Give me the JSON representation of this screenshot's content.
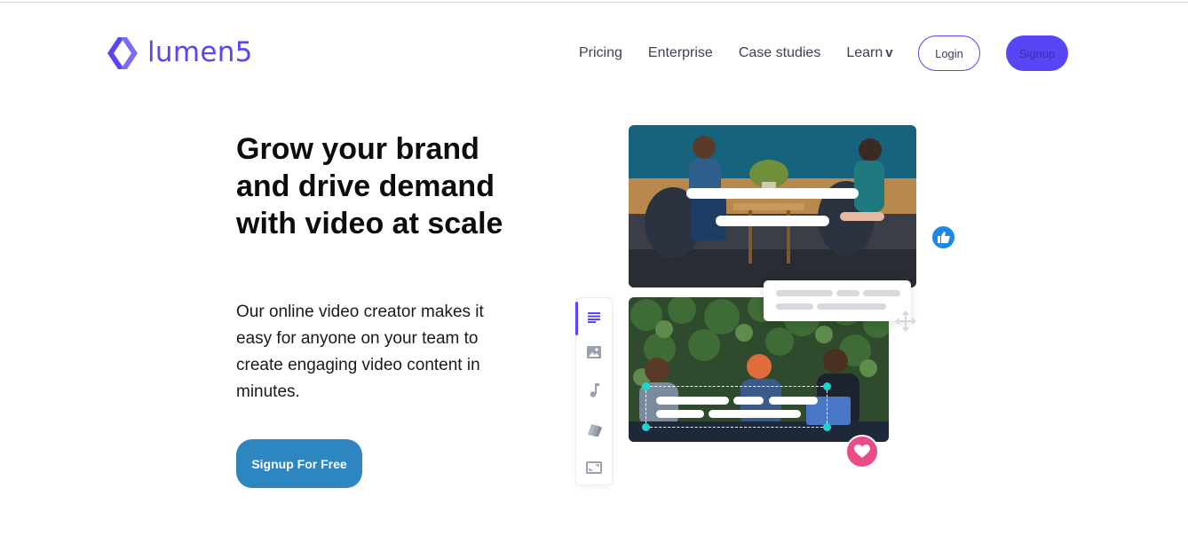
{
  "brand": {
    "name": "lumen5",
    "accent": "#5846f6",
    "logo_icon": "lumen5-diamond-logo"
  },
  "nav": {
    "links": [
      {
        "label": "Pricing"
      },
      {
        "label": "Enterprise"
      },
      {
        "label": "Case studies"
      },
      {
        "label": "Learn",
        "suffix": "v"
      }
    ],
    "login_label": "Login",
    "signup_label": "Signup"
  },
  "hero": {
    "title": "Grow your brand and drive demand with video at scale",
    "subtitle": "Our online video creator makes it easy for anyone on your team to create engaging video content in minutes.",
    "cta_label": "Signup For Free",
    "cta_color": "#2e86c1"
  },
  "illustration": {
    "toolbar_icons": [
      "text-icon",
      "image-icon",
      "music-icon",
      "color-palette-icon",
      "aspect-ratio-icon"
    ],
    "badges": {
      "like": "thumbs-up-icon",
      "like_color": "#1e88e5",
      "heart": "heart-icon",
      "heart_color": "#ea4c89"
    },
    "handle_color": "#18d6d0"
  }
}
